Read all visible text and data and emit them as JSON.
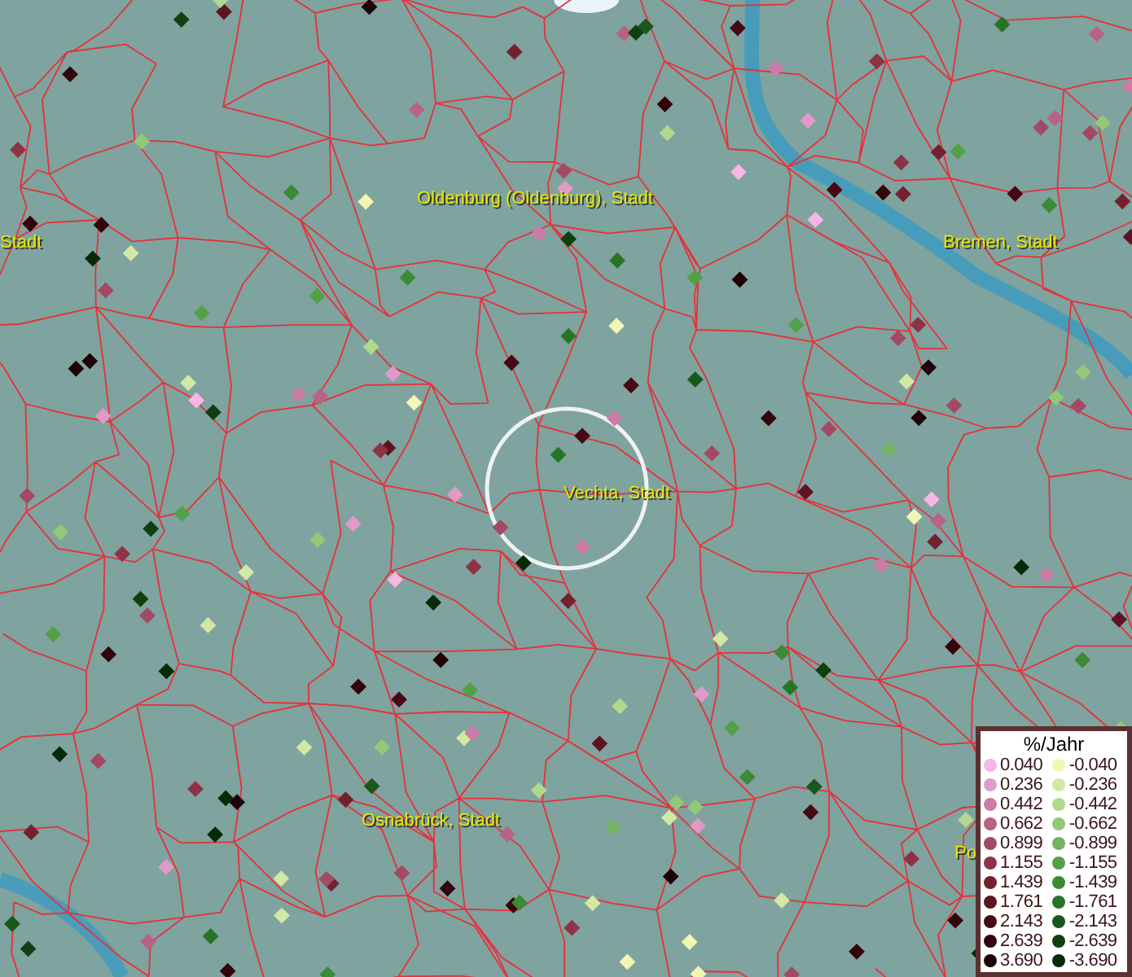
{
  "map": {
    "place_labels": [
      "Oldenburg (Oldenburg), Stadt",
      "Stadt",
      "Bremen, Stadt",
      "Vechta, Stadt",
      "Osnabrück, Stadt",
      "Po"
    ]
  },
  "legend": {
    "title": "%/Jahr",
    "rows": [
      {
        "positive": {
          "label": "0.040",
          "color": "#f7b6e6"
        },
        "negative": {
          "label": "-0.040",
          "color": "#f2f5b4"
        }
      },
      {
        "positive": {
          "label": "0.236",
          "color": "#e09ac8"
        },
        "negative": {
          "label": "-0.236",
          "color": "#d2e8a4"
        }
      },
      {
        "positive": {
          "label": "0.442",
          "color": "#cc7ca6"
        },
        "negative": {
          "label": "-0.442",
          "color": "#b2d88e"
        }
      },
      {
        "positive": {
          "label": "0.662",
          "color": "#b86284"
        },
        "negative": {
          "label": "-0.662",
          "color": "#92c877"
        }
      },
      {
        "positive": {
          "label": "0.899",
          "color": "#a24a64"
        },
        "negative": {
          "label": "-0.899",
          "color": "#72b462"
        }
      },
      {
        "positive": {
          "label": "1.155",
          "color": "#8c3446"
        },
        "negative": {
          "label": "-1.155",
          "color": "#52a048"
        }
      },
      {
        "positive": {
          "label": "1.439",
          "color": "#73212f"
        },
        "negative": {
          "label": "-1.439",
          "color": "#3a8a36"
        }
      },
      {
        "positive": {
          "label": "1.761",
          "color": "#5e1420"
        },
        "negative": {
          "label": "-1.761",
          "color": "#287426"
        }
      },
      {
        "positive": {
          "label": "2.143",
          "color": "#470a14"
        },
        "negative": {
          "label": "-2.143",
          "color": "#18581a"
        }
      },
      {
        "positive": {
          "label": "2.639",
          "color": "#32050c"
        },
        "negative": {
          "label": "-2.639",
          "color": "#0e4010"
        }
      },
      {
        "positive": {
          "label": "3.690",
          "color": "#1e0206"
        },
        "negative": {
          "label": "-3.690",
          "color": "#062a08"
        }
      }
    ]
  }
}
